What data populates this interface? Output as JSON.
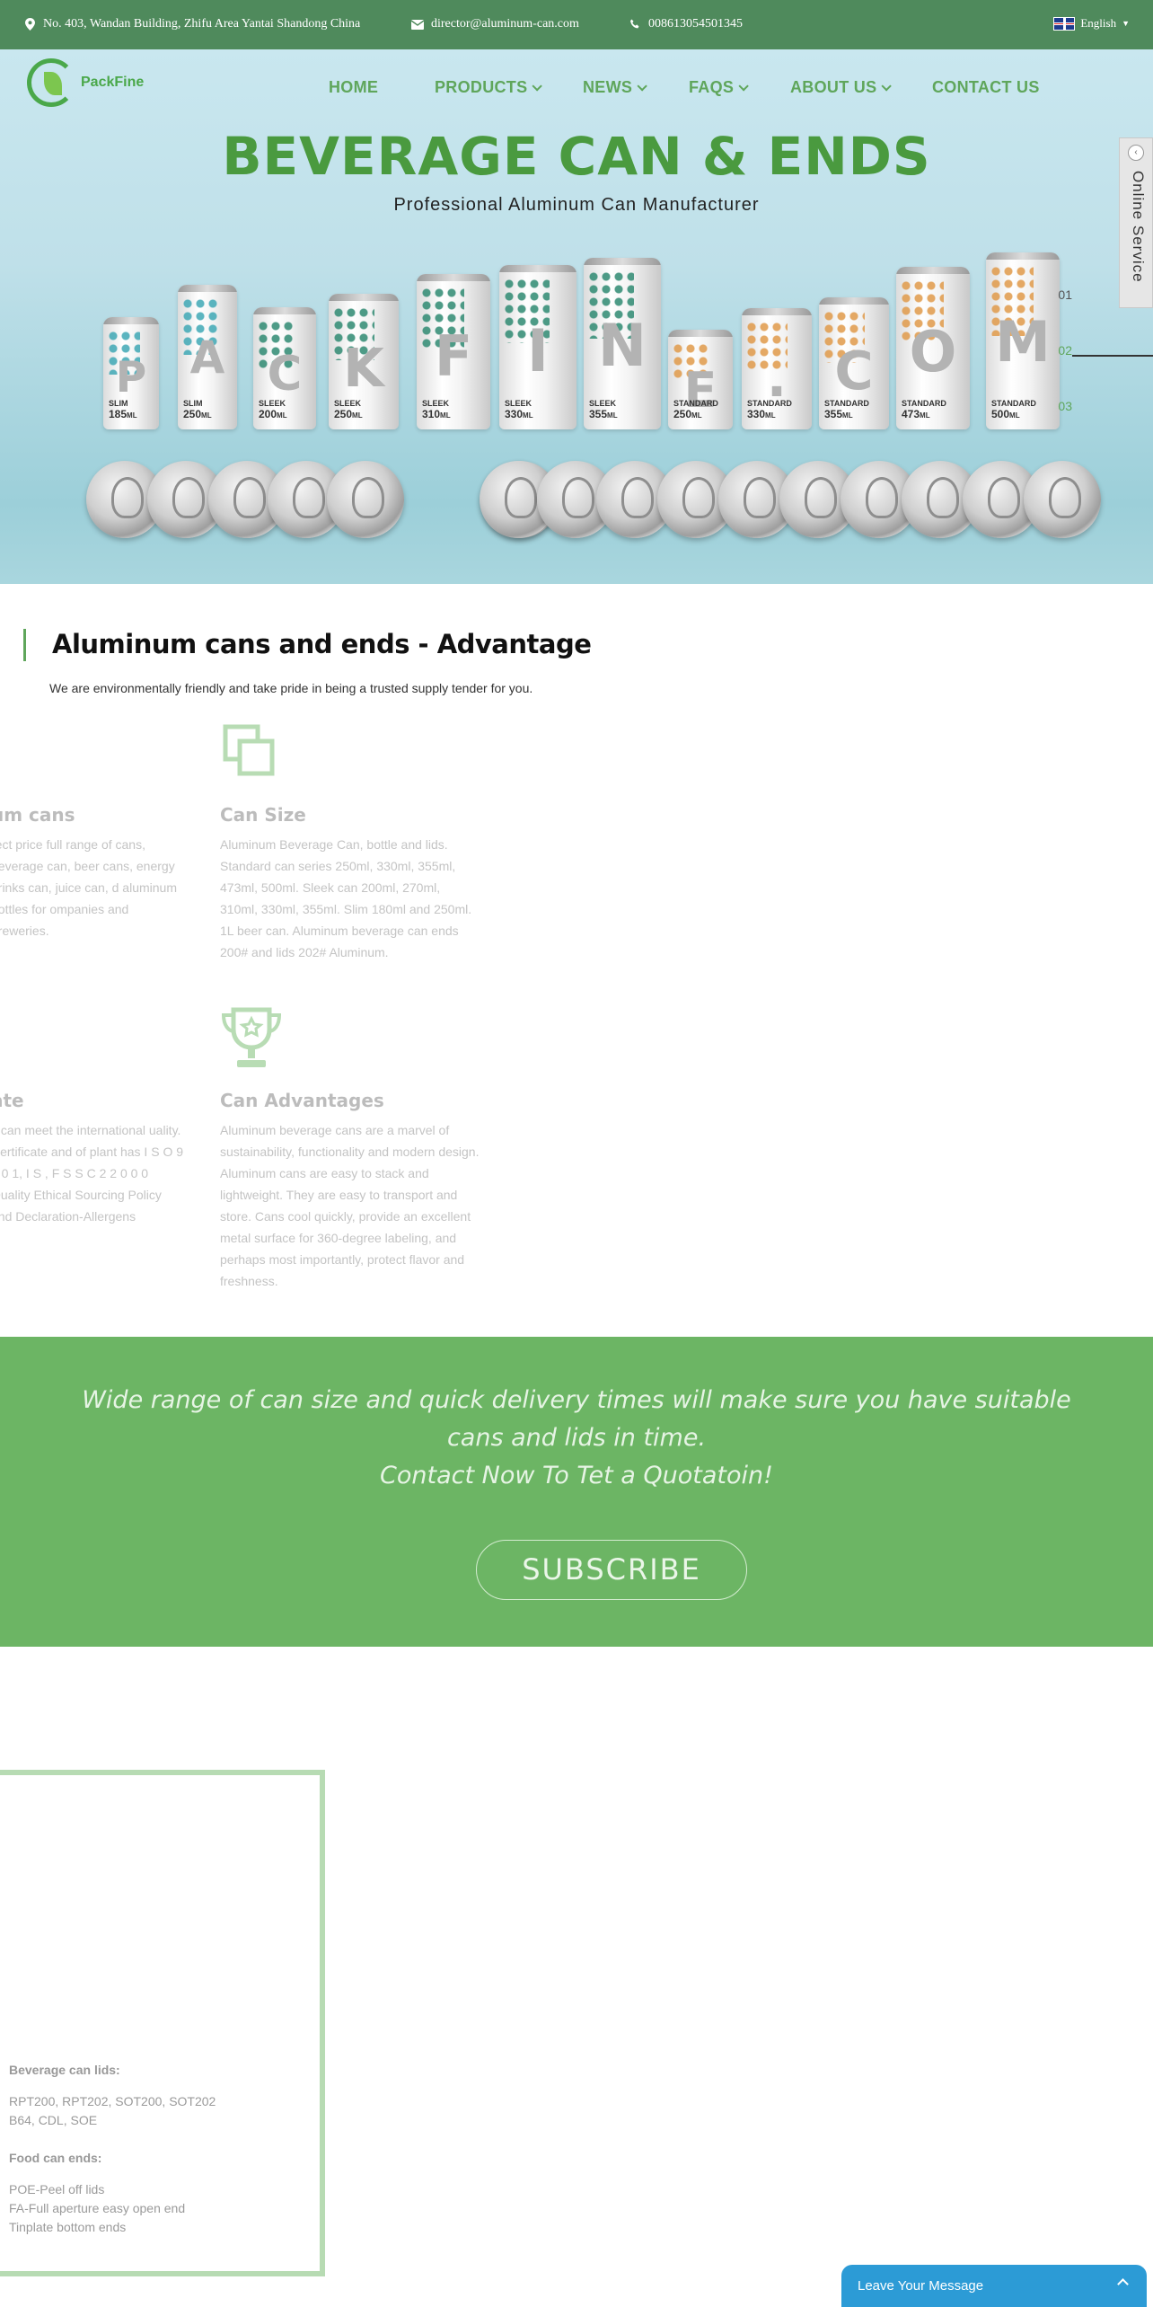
{
  "topbar": {
    "address": "No. 403, Wandan Building, Zhifu Area Yantai Shandong China",
    "email": "director@aluminum-can.com",
    "phone": "008613054501345",
    "language": "English"
  },
  "logo": {
    "text": "PackFine"
  },
  "nav": {
    "items": [
      {
        "label": "HOME"
      },
      {
        "label": "PRODUCTS"
      },
      {
        "label": "NEWS"
      },
      {
        "label": "FAQS"
      },
      {
        "label": "ABOUT US"
      },
      {
        "label": "CONTACT US"
      }
    ]
  },
  "hero": {
    "title": "BEVERAGE CAN & ENDS",
    "subtitle": "Professional Aluminum Can Manufacturer",
    "slides": [
      "01",
      "02",
      "03"
    ],
    "cans": [
      {
        "letter": "P",
        "type": "SLIM",
        "size": "185",
        "unit": "ML"
      },
      {
        "letter": "A",
        "type": "SLIM",
        "size": "250",
        "unit": "ML"
      },
      {
        "letter": "C",
        "type": "SLEEK",
        "size": "200",
        "unit": "ML"
      },
      {
        "letter": "K",
        "type": "SLEEK",
        "size": "250",
        "unit": "ML"
      },
      {
        "letter": "F",
        "type": "SLEEK",
        "size": "310",
        "unit": "ML"
      },
      {
        "letter": "I",
        "type": "SLEEK",
        "size": "330",
        "unit": "ML"
      },
      {
        "letter": "N",
        "type": "SLEEK",
        "size": "355",
        "unit": "ML"
      },
      {
        "letter": "E",
        "type": "STANDARD",
        "size": "250",
        "unit": "ML"
      },
      {
        "letter": ".",
        "type": "STANDARD",
        "size": "330",
        "unit": "ML"
      },
      {
        "letter": "C",
        "type": "STANDARD",
        "size": "355",
        "unit": "ML"
      },
      {
        "letter": "O",
        "type": "STANDARD",
        "size": "473",
        "unit": "ML"
      },
      {
        "letter": "M",
        "type": "STANDARD",
        "size": "500",
        "unit": "ML"
      }
    ]
  },
  "online_service": {
    "label": "Online Service"
  },
  "advantage": {
    "title": "Aluminum cans and ends - Advantage",
    "subtitle": "We are environmentally friendly and take pride in being a trusted supply tender for you.",
    "features": [
      {
        "icon": "cube-icon",
        "heading": "um cans",
        "text": "rect price full range of cans, beverage can, beer cans, energy drinks can, juice can, d aluminum bottles for ompanies and breweries."
      },
      {
        "icon": "copy-squares-icon",
        "heading": "Can Size",
        "text": "Aluminum Beverage Can, bottle and lids. Standard can series 250ml, 330ml, 355ml, 473ml, 500ml. Sleek can 200ml, 270ml, 310ml, 330ml, 355ml. Slim 180ml and 250ml. 1L beer can. Aluminum beverage can ends 200# and lids 202# Aluminum."
      },
      {
        "icon": "certificate-icon",
        "heading": "ate",
        "text": "s can meet the international uality. Certificate and of plant has I S O 9 0 0 1, I S , F S S C 2 2 0 0 0 Quality Ethical Sourcing Policy and Declaration-Allergens"
      },
      {
        "icon": "trophy-icon",
        "heading": "Can Advantages",
        "text": "Aluminum beverage cans are a marvel of sustainability, functionality and modern design. Aluminum cans are easy to stack and lightweight. They are easy to transport and store. Cans cool quickly, provide an excellent metal surface for 360-degree labeling, and perhaps most importantly, protect flavor and freshness."
      }
    ]
  },
  "cta": {
    "line1": "Wide range of can size and quick delivery times will make sure you have suitable",
    "line2": "cans and lids in time.",
    "line3": "Contact Now To Tet a Quotatoin!",
    "button": "SUBSCRIBE"
  },
  "products_box": {
    "beverage_heading": "Beverage can lids:",
    "beverage_line1": "RPT200, RPT202, SOT200, SOT202",
    "beverage_line2": "B64, CDL, SOE",
    "food_heading": "Food can ends:",
    "food_line1": "POE-Peel off lids",
    "food_line2": "FA-Full aperture easy open end",
    "food_line3": "Tinplate bottom ends"
  },
  "leave_message": {
    "label": "Leave Your Message"
  },
  "colors": {
    "topbar": "#4f8a5c",
    "brand_green": "#5fa65b",
    "cta_band": "#6cb564",
    "chat_blue": "#2c9bd6"
  }
}
